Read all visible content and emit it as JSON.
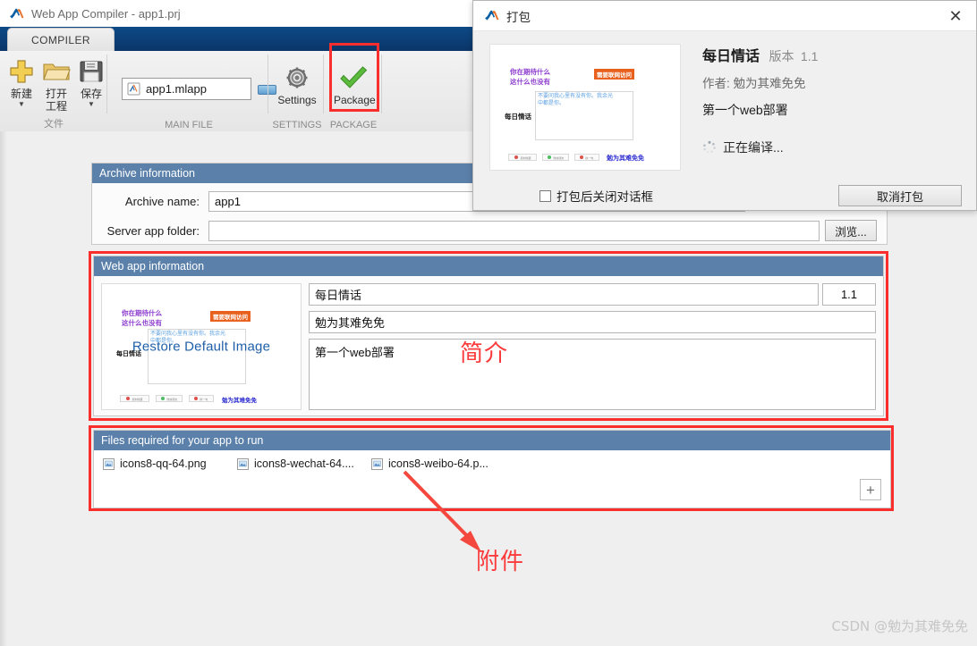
{
  "window": {
    "title": "Web App Compiler - app1.prj",
    "logo_icon": "matlab-membrane-icon"
  },
  "ribbon": {
    "tab": "COMPILER",
    "groups": [
      {
        "name": "file",
        "label": "文件",
        "buttons": [
          {
            "label": "新建",
            "icon": "plus-icon",
            "caret": "▼"
          },
          {
            "label": "打开\n工程",
            "icon": "folder-icon",
            "caret": ""
          },
          {
            "label": "保存",
            "icon": "floppy-disk-icon",
            "caret": "▼"
          }
        ]
      },
      {
        "name": "main-file",
        "label": "MAIN FILE"
      },
      {
        "name": "settings",
        "label": "SETTINGS",
        "button": "Settings",
        "icon": "gear-icon"
      },
      {
        "name": "package",
        "label": "PACKAGE",
        "button": "Package",
        "icon": "green-check-icon"
      }
    ],
    "main_file": {
      "value": "app1.mlapp",
      "icon": "mlapp-file-icon"
    },
    "new_label": "新建",
    "open_label_line1": "打开",
    "open_label_line2": "工程",
    "save_label": "保存",
    "settings_label": "Settings",
    "package_label": "Package"
  },
  "archive_panel": {
    "header": "Archive information",
    "archive_name_label": "Archive name:",
    "archive_name_value": "app1",
    "server_folder_label": "Server app folder:",
    "server_folder_value": "",
    "browse_label": "浏览..."
  },
  "webapp_panel": {
    "header": "Web app information",
    "name_value": "每日情话",
    "version_value": "1.1",
    "author_value": "勉为其难免免",
    "summary_value": "第一个web部署",
    "restore_image_label": "Restore Default Image"
  },
  "files_panel": {
    "header": "Files required for your app to run",
    "files": [
      {
        "name": "icons8-qq-64.png",
        "icon": "image-file-icon"
      },
      {
        "name": "icons8-wechat-64....",
        "icon": "image-file-icon"
      },
      {
        "name": "icons8-weibo-64.p...",
        "icon": "image-file-icon"
      }
    ],
    "add_label": "+"
  },
  "annotations": [
    {
      "name": "summary-annotation",
      "text": "简介"
    },
    {
      "name": "attachment-annotation",
      "text": "附件"
    }
  ],
  "dialog": {
    "title": "打包",
    "close_icon": "close-x-icon",
    "app_name": "每日情话",
    "version_prefix": "版本",
    "version": "1.1",
    "author_line": "作者: 勉为其难免免",
    "description": "第一个web部署",
    "status_text": "正在编译...",
    "status_icon": "spinner-icon",
    "checkbox_label": "打包后关闭对话框",
    "checkbox_checked": false,
    "cancel_label": "取消打包"
  },
  "app_preview": {
    "question_line1": "你在期待什么",
    "question_line2": "这什么也没有",
    "badge": "需要联网访问",
    "side_label": "每日情话",
    "textarea_line1": "不要问我心里有没有你。我余光",
    "textarea_line2": "中都是你。",
    "signature": "勉为其难免免",
    "buttons": [
      "复制收藏",
      "微信朋友",
      "换一句"
    ]
  },
  "watermark": "CSDN @勉为其难免免",
  "colors": {
    "panel_header": "#5b81ab",
    "ribbon_tab_bar": "#0b3d72",
    "annotation_red": "#fb3b3b",
    "highlight_box": "#fb2e2e",
    "badge_orange": "#e8601c",
    "purple_text": "#8e3ecf",
    "blue_text": "#5a9fe0",
    "signature_blue": "#2b2bcf"
  }
}
